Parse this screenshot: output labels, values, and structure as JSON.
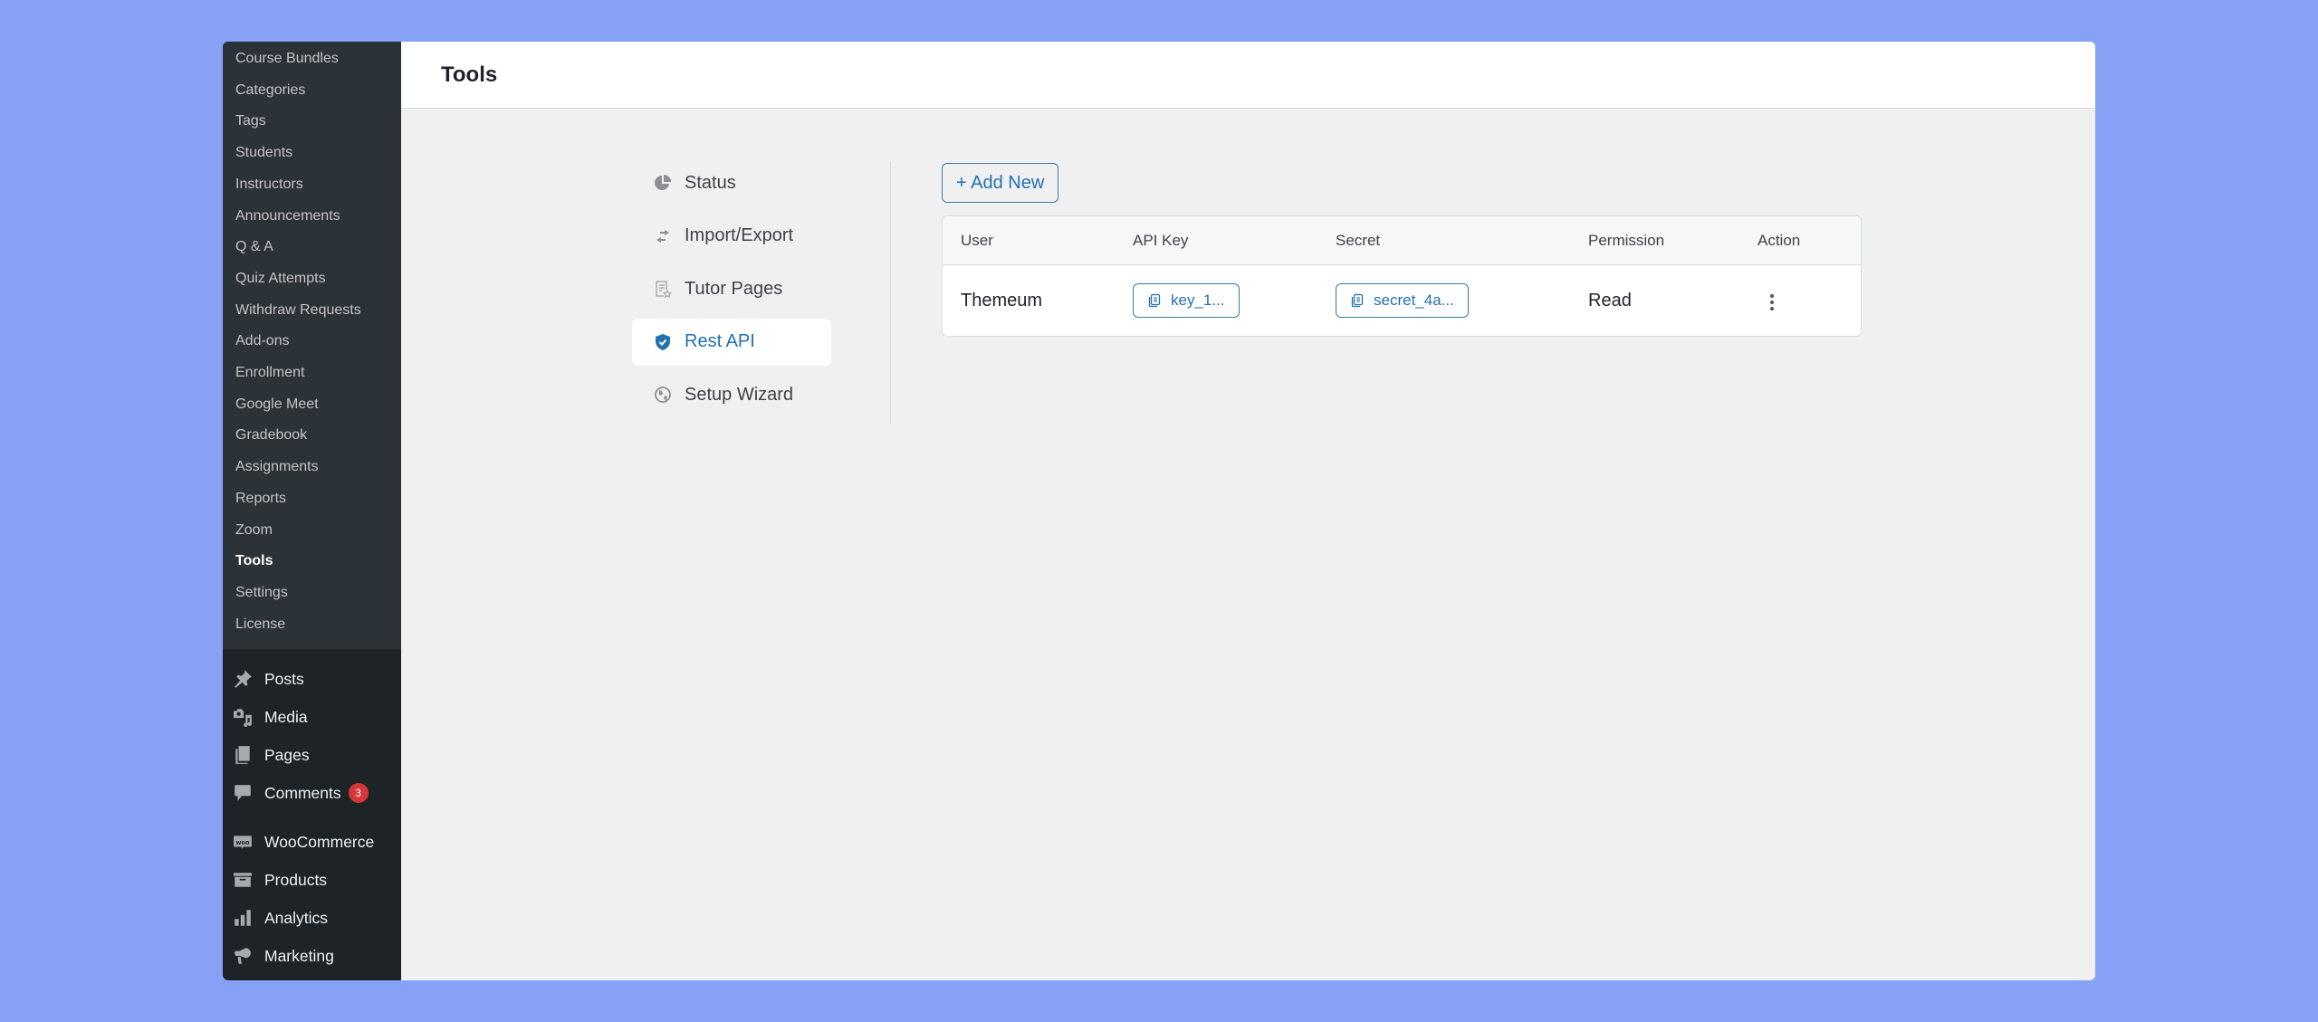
{
  "sidebar": {
    "submenu": [
      {
        "label": "Course Bundles"
      },
      {
        "label": "Categories"
      },
      {
        "label": "Tags"
      },
      {
        "label": "Students"
      },
      {
        "label": "Instructors"
      },
      {
        "label": "Announcements"
      },
      {
        "label": "Q & A"
      },
      {
        "label": "Quiz Attempts"
      },
      {
        "label": "Withdraw Requests"
      },
      {
        "label": "Add-ons"
      },
      {
        "label": "Enrollment"
      },
      {
        "label": "Google Meet"
      },
      {
        "label": "Gradebook"
      },
      {
        "label": "Assignments"
      },
      {
        "label": "Reports"
      },
      {
        "label": "Zoom"
      },
      {
        "label": "Tools",
        "current": true
      },
      {
        "label": "Settings"
      },
      {
        "label": "License"
      }
    ],
    "menu": [
      {
        "label": "Posts",
        "icon": "pin-icon"
      },
      {
        "label": "Media",
        "icon": "media-icon"
      },
      {
        "label": "Pages",
        "icon": "pages-icon"
      },
      {
        "label": "Comments",
        "icon": "comment-icon",
        "badge": "3"
      },
      {
        "label": "WooCommerce",
        "icon": "woo-icon"
      },
      {
        "label": "Products",
        "icon": "archive-icon"
      },
      {
        "label": "Analytics",
        "icon": "bar-chart-icon"
      },
      {
        "label": "Marketing",
        "icon": "megaphone-icon"
      }
    ]
  },
  "header": {
    "title": "Tools"
  },
  "tools_nav": [
    {
      "label": "Status",
      "icon": "pie-chart-icon"
    },
    {
      "label": "Import/Export",
      "icon": "arrows-swap-icon"
    },
    {
      "label": "Tutor Pages",
      "icon": "page-star-icon"
    },
    {
      "label": "Rest API",
      "icon": "shield-check-icon",
      "active": true
    },
    {
      "label": "Setup Wizard",
      "icon": "globe-icon"
    }
  ],
  "api": {
    "add_new_label": "+ Add New",
    "columns": [
      "User",
      "API Key",
      "Secret",
      "Permission",
      "Action"
    ],
    "rows": [
      {
        "user": "Themeum",
        "api_key": "key_1...",
        "secret": "secret_4a...",
        "permission": "Read"
      }
    ]
  },
  "colors": {
    "accent": "#2271b1",
    "sidebar_bg": "#1d2327",
    "submenu_bg": "#2c3338",
    "badge": "#d63638",
    "page_bg": "#87a1f7"
  }
}
